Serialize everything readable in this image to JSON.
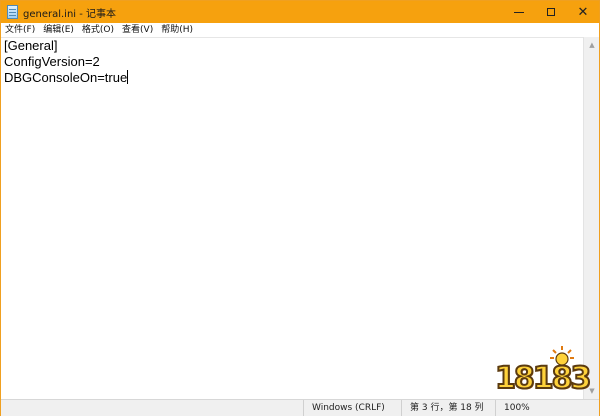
{
  "window": {
    "title": "general.ini - 记事本",
    "border_color": "#f0a020",
    "titlebar_color": "#f6a10e"
  },
  "controls": {
    "minimize_icon": "minimize-icon",
    "maximize_icon": "maximize-icon",
    "close_icon": "close-icon",
    "close_glyph": "✕"
  },
  "menu": {
    "items": [
      {
        "label": "文件(F)"
      },
      {
        "label": "编辑(E)"
      },
      {
        "label": "格式(O)"
      },
      {
        "label": "查看(V)"
      },
      {
        "label": "帮助(H)"
      }
    ]
  },
  "editor": {
    "lines": [
      "[General]",
      "ConfigVersion=2",
      "DBGConsoleOn=true"
    ]
  },
  "statusbar": {
    "encoding": "Windows (CRLF)",
    "position": "第 3 行，第 18 列",
    "zoom": "100%"
  },
  "watermark": {
    "text": "18183"
  }
}
